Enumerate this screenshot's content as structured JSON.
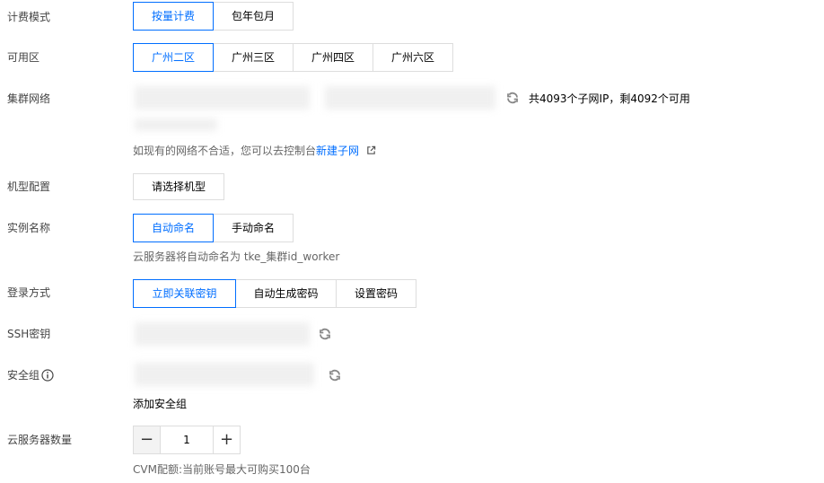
{
  "billing": {
    "label": "计费模式",
    "options": [
      "按量计费",
      "包年包月"
    ],
    "selected": 0
  },
  "zone": {
    "label": "可用区",
    "options": [
      "广州二区",
      "广州三区",
      "广州四区",
      "广州六区"
    ],
    "selected": 0
  },
  "network": {
    "label": "集群网络",
    "ip_info": "共4093个子网IP，剩4092个可用",
    "hint_prefix": "如现有的网络不合适，您可以去控制台",
    "hint_link": "新建子网"
  },
  "machine": {
    "label": "机型配置",
    "button": "请选择机型"
  },
  "instance_name": {
    "label": "实例名称",
    "options": [
      "自动命名",
      "手动命名"
    ],
    "selected": 0,
    "hint": "云服务器将自动命名为 tke_集群id_worker"
  },
  "login": {
    "label": "登录方式",
    "options": [
      "立即关联密钥",
      "自动生成密码",
      "设置密码"
    ],
    "selected": 0
  },
  "ssh": {
    "label": "SSH密钥"
  },
  "security_group": {
    "label": "安全组",
    "add_link": "添加安全组"
  },
  "count": {
    "label": "云服务器数量",
    "value": "1",
    "minus": "−",
    "plus": "+",
    "quota": "CVM配额:当前账号最大可购买100台"
  },
  "colors": {
    "accent": "#006eff",
    "border": "#dddddd"
  },
  "icons": {
    "refresh": "refresh-icon",
    "external": "external-link-icon",
    "info": "info-icon"
  }
}
